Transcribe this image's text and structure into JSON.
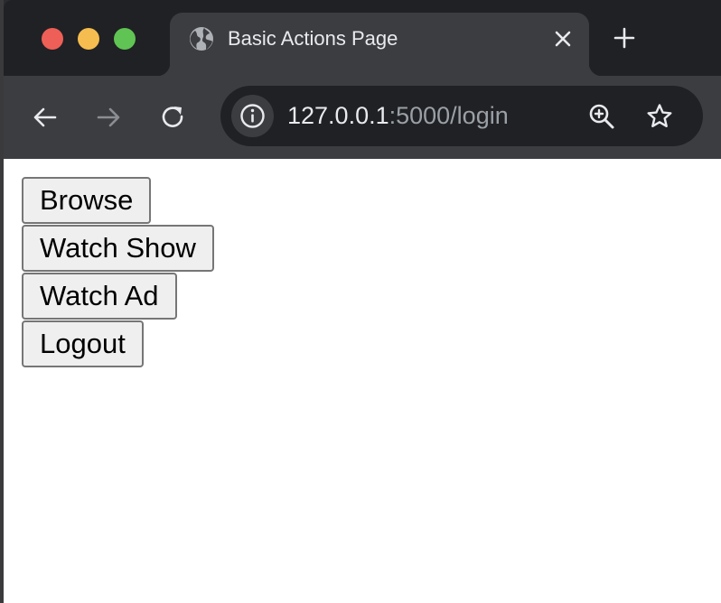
{
  "browser": {
    "tab": {
      "title": "Basic Actions Page",
      "favicon": "globe-icon"
    },
    "address_bar": {
      "host": "127.0.0.1",
      "path": ":5000/login"
    }
  },
  "page": {
    "buttons": [
      {
        "label": "Browse"
      },
      {
        "label": "Watch Show"
      },
      {
        "label": "Watch Ad"
      },
      {
        "label": "Logout"
      }
    ]
  },
  "colors": {
    "chrome_dark": "#202124",
    "chrome_toolbar": "#3c3d41",
    "traffic_red": "#ee5f57",
    "traffic_yellow": "#f5bd4f",
    "traffic_green": "#5fc453",
    "button_bg": "#efefef",
    "button_border": "#767676"
  }
}
